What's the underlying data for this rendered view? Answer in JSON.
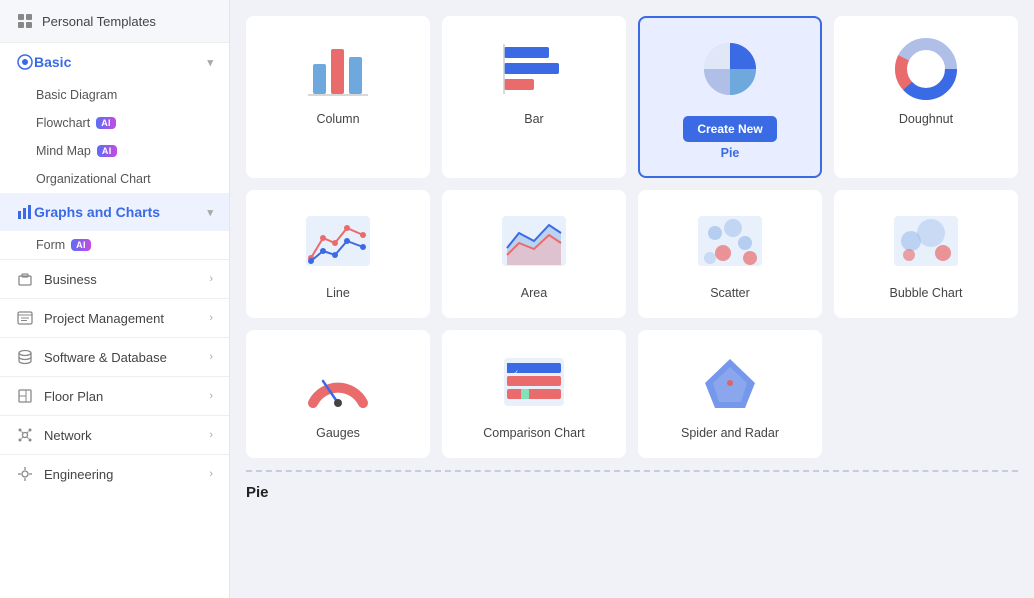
{
  "sidebar": {
    "personal_templates_label": "Personal Templates",
    "basic_section": {
      "label": "Basic",
      "items": [
        {
          "id": "basic-diagram",
          "label": "Basic Diagram",
          "ai": false
        },
        {
          "id": "flowchart",
          "label": "Flowchart",
          "ai": true
        },
        {
          "id": "mind-map",
          "label": "Mind Map",
          "ai": true
        },
        {
          "id": "org-chart",
          "label": "Organizational Chart",
          "ai": false
        }
      ]
    },
    "active_section": {
      "label": "Graphs and Charts"
    },
    "sub_items": [
      {
        "id": "form",
        "label": "Form",
        "ai": true
      }
    ],
    "main_items": [
      {
        "id": "business",
        "label": "Business"
      },
      {
        "id": "project-management",
        "label": "Project Management"
      },
      {
        "id": "software-database",
        "label": "Software & Database"
      },
      {
        "id": "floor-plan",
        "label": "Floor Plan"
      },
      {
        "id": "network",
        "label": "Network"
      },
      {
        "id": "engineering",
        "label": "Engineering"
      }
    ]
  },
  "chart_grid": {
    "row1": [
      {
        "id": "column",
        "label": "Column",
        "selected": false
      },
      {
        "id": "bar",
        "label": "Bar",
        "selected": false
      },
      {
        "id": "pie",
        "label": "Pie",
        "selected": true,
        "create_new": true
      },
      {
        "id": "doughnut",
        "label": "Doughnut",
        "selected": false
      }
    ],
    "row2": [
      {
        "id": "line",
        "label": "Line",
        "selected": false
      },
      {
        "id": "area",
        "label": "Area",
        "selected": false
      },
      {
        "id": "scatter",
        "label": "Scatter",
        "selected": false
      },
      {
        "id": "bubble",
        "label": "Bubble Chart",
        "selected": false
      }
    ],
    "row3": [
      {
        "id": "gauges",
        "label": "Gauges",
        "selected": false
      },
      {
        "id": "comparison",
        "label": "Comparison Chart",
        "selected": false
      },
      {
        "id": "spider",
        "label": "Spider and Radar",
        "selected": false
      }
    ]
  },
  "create_new_label": "Create New",
  "section_footer_label": "Pie"
}
